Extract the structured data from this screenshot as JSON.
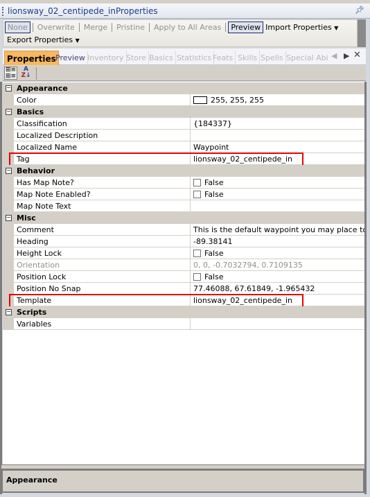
{
  "window": {
    "title": "lionsway_02_centipede_inProperties",
    "pin_icon": "pin-icon"
  },
  "toolbar": {
    "items": [
      {
        "label": "None",
        "state": "selected-disabled"
      },
      {
        "label": "Overwrite"
      },
      {
        "label": "Merge"
      },
      {
        "label": "Pristine"
      },
      {
        "label": "Apply to All Areas"
      },
      {
        "label": "Preview",
        "state": "selected"
      },
      {
        "label": "Import Properties"
      },
      {
        "label": "Export Properties"
      }
    ]
  },
  "tabs": [
    "Properties",
    "Preview",
    "Inventory",
    "Store",
    "Basics",
    "Statistics",
    "Feats",
    "Skills",
    "Spells",
    "Special Abili"
  ],
  "active_tab": "Properties",
  "grid": {
    "rows": [
      {
        "type": "cat",
        "name": "Appearance"
      },
      {
        "name": "Color",
        "value": "255, 255, 255",
        "swatch": "#ffffff"
      },
      {
        "type": "cat",
        "name": "Basics"
      },
      {
        "name": "Classification",
        "value": "{184337}"
      },
      {
        "name": "Localized Description",
        "value": ""
      },
      {
        "name": "Localized Name",
        "value": "Waypoint"
      },
      {
        "name": "Tag",
        "value": "lionsway_02_centipede_in",
        "highlight": true
      },
      {
        "type": "cat",
        "name": "Behavior"
      },
      {
        "name": "Has Map Note?",
        "value": "False",
        "checkbox": true
      },
      {
        "name": "Map Note Enabled?",
        "value": "False",
        "checkbox": true
      },
      {
        "name": "Map Note Text",
        "value": ""
      },
      {
        "type": "cat",
        "name": "Misc"
      },
      {
        "name": "Comment",
        "value": "This is the default waypoint you may place to se..."
      },
      {
        "name": "Heading",
        "value": "-89.38141"
      },
      {
        "name": "Height Lock",
        "value": "False",
        "checkbox": true
      },
      {
        "name": "Orientation",
        "value": "0, 0, -0.7032794, 0.7109135",
        "disabled": true
      },
      {
        "name": "Position Lock",
        "value": "False",
        "checkbox": true
      },
      {
        "name": "Position No Snap",
        "value": "77.46088, 67.61849, -1.965432"
      },
      {
        "name": "Template",
        "value": "lionsway_02_centipede_in",
        "highlight": true
      },
      {
        "type": "cat",
        "name": "Scripts"
      },
      {
        "name": "Variables",
        "value": ""
      }
    ]
  },
  "description": {
    "title": "Appearance"
  },
  "colors": {
    "highlight": "#e80000",
    "active_tab": "#f8b860",
    "category_bg": "#d4d0c8"
  }
}
